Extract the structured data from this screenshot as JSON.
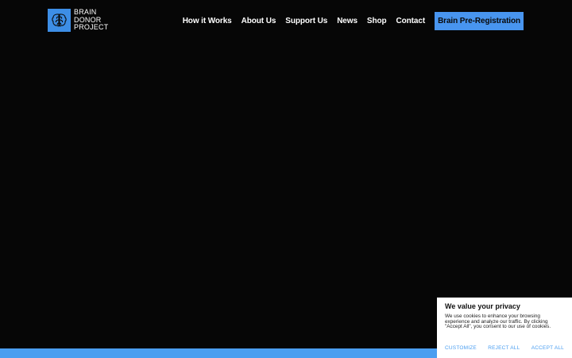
{
  "header": {
    "logo": {
      "lines": [
        "BRAIN",
        "DONOR",
        "PROJECT"
      ],
      "icon": "brain-icon"
    },
    "nav": [
      {
        "label": "How it Works"
      },
      {
        "label": "About Us"
      },
      {
        "label": "Support Us"
      },
      {
        "label": "News"
      },
      {
        "label": "Shop"
      },
      {
        "label": "Contact"
      }
    ],
    "cta_label": "Brain Pre-Registration"
  },
  "cookie_banner": {
    "title": "We value your privacy",
    "text": "We use cookies to enhance your browsing experience and analyze our traffic. By clicking \"Accept All\", you consent to our use of cookies.",
    "customize_label": "CUSTOMIZE",
    "reject_label": "REJECT ALL",
    "accept_label": "ACCEPT ALL"
  },
  "colors": {
    "background": "#060606",
    "accent": "#4895ef",
    "text": "#ffffff"
  }
}
